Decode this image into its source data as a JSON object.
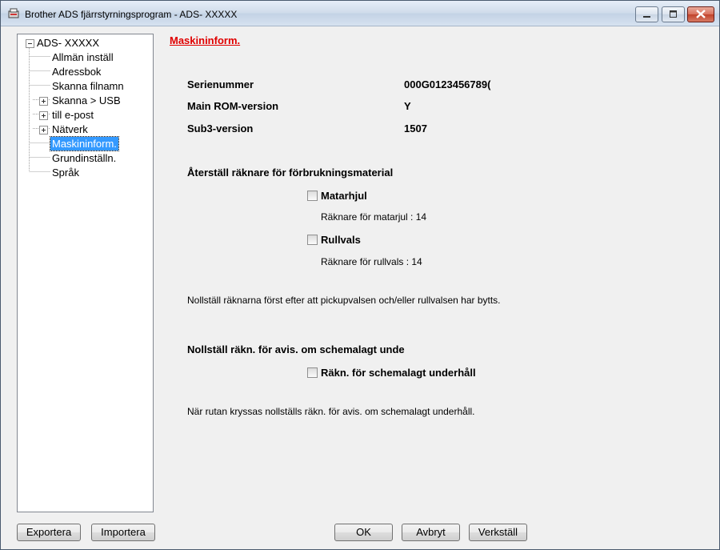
{
  "window": {
    "title": "Brother ADS fjärrstyrningsprogram - ADS- XXXXX"
  },
  "tree": {
    "root": "ADS- XXXXX",
    "items": [
      {
        "label": "Allmän inställ",
        "expandable": false
      },
      {
        "label": "Adressbok",
        "expandable": false
      },
      {
        "label": "Skanna filnamn",
        "expandable": false
      },
      {
        "label": "Skanna > USB",
        "expandable": true
      },
      {
        "label": "till e-post",
        "expandable": true
      },
      {
        "label": "Nätverk",
        "expandable": true
      },
      {
        "label": "Maskininform.",
        "expandable": false,
        "selected": true
      },
      {
        "label": "Grundinställn.",
        "expandable": false
      },
      {
        "label": "Språk",
        "expandable": false
      }
    ]
  },
  "main": {
    "heading": "Maskininform.",
    "info": {
      "serial_label": "Serienummer",
      "serial_value": "000G0123456789(",
      "rom_label": "Main ROM-version",
      "rom_value": "Y",
      "sub3_label": "Sub3-version",
      "sub3_value": "1507"
    },
    "reset_section": {
      "title": "Återställ räknare för förbrukningsmaterial",
      "feed_roller_label": "Matarhjul",
      "feed_roller_counter": "Räknare för matarjul : 14",
      "roller_label": "Rullvals",
      "roller_counter": "Räknare för rullvals : 14",
      "note": "Nollställ räknarna först efter att pickupvalsen och/eller rullvalsen har bytts."
    },
    "maintenance_section": {
      "title": "Nollställ räkn. för avis. om schemalagt unde",
      "checkbox_label": "Räkn. för schemalagt underhåll",
      "note": "När rutan kryssas nollställs räkn. för avis. om schemalagt underhåll."
    }
  },
  "buttons": {
    "export": "Exportera",
    "import": "Importera",
    "ok": "OK",
    "cancel": "Avbryt",
    "apply": "Verkställ"
  },
  "colors": {
    "heading": "#e00000",
    "selection": "#3399ff"
  }
}
